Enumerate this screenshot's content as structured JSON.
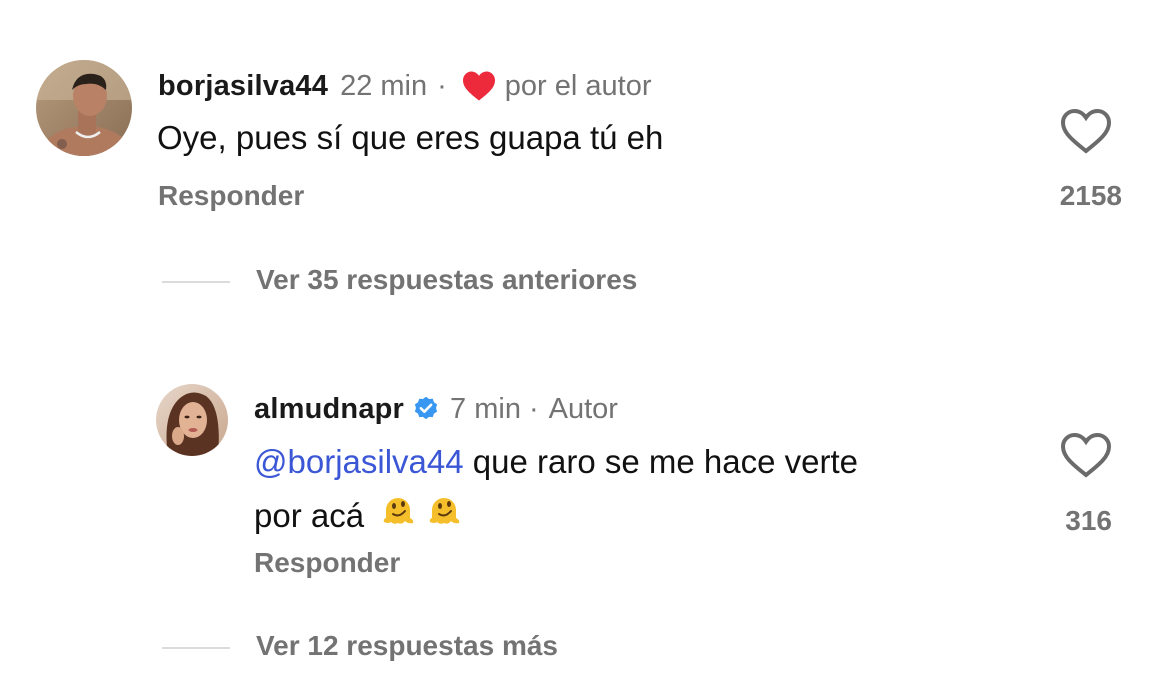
{
  "comments": [
    {
      "username": "borjasilva44",
      "time": "22 min",
      "separator": "·",
      "liked_by_author": "por el autor",
      "text": "Oye, pues sí que eres guapa tú eh",
      "reply_label": "Responder",
      "like_count": "2158",
      "icons": {
        "like": "heart-outline-icon",
        "author_like": "heart-filled-icon"
      },
      "colors": {
        "author_heart": "#ed2a3b"
      }
    },
    {
      "username": "almudnapr",
      "verified": true,
      "time": "7 min",
      "separator": "·",
      "author_badge": "Autor",
      "mention": "@borjasilva44",
      "text_line1": " que raro se me hace verte",
      "text_line2": "por acá",
      "emojis": [
        "melting-face-emoji",
        "melting-face-emoji"
      ],
      "reply_label": "Responder",
      "like_count": "316",
      "icons": {
        "like": "heart-outline-icon",
        "verified": "verified-badge-icon"
      },
      "colors": {
        "mention": "#3b57d6",
        "verified_badge": "#3897f0"
      }
    }
  ],
  "threads": {
    "previous_replies": "Ver 35 respuestas anteriores",
    "more_replies": "Ver 12 respuestas más"
  }
}
